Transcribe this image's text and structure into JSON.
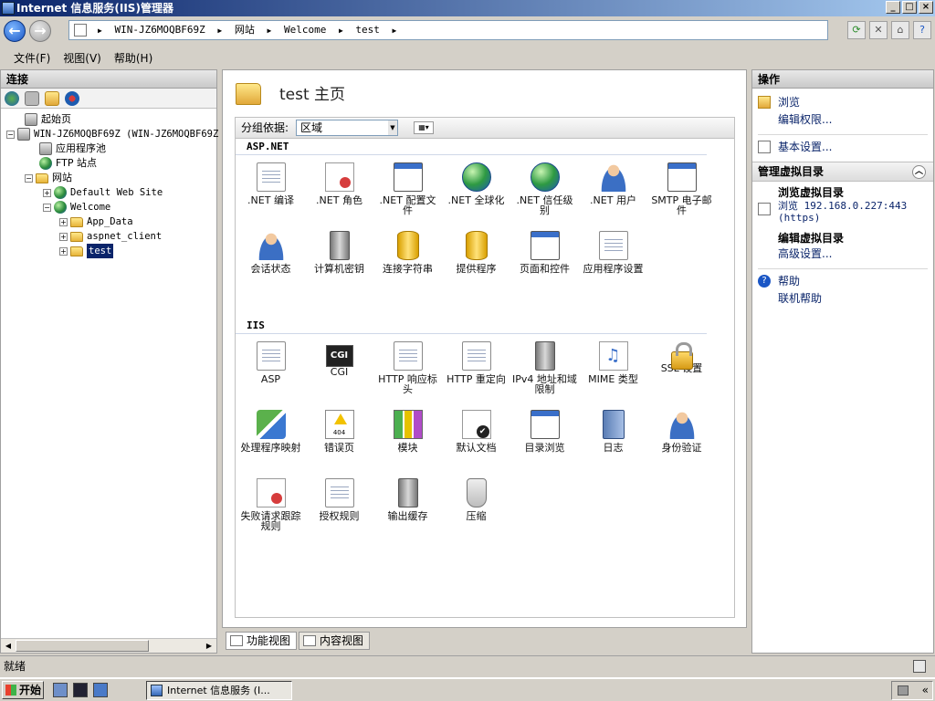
{
  "window": {
    "title": "Internet 信息服务(IIS)管理器"
  },
  "address": {
    "segments": [
      "WIN-JZ6MOQBF69Z",
      "网站",
      "Welcome",
      "test"
    ]
  },
  "menu": [
    "文件(F)",
    "视图(V)",
    "帮助(H)"
  ],
  "connections": {
    "title": "连接",
    "tree": {
      "start": "起始页",
      "server": "WIN-JZ6MOQBF69Z (WIN-JZ6MOQBF69Z",
      "apppools": "应用程序池",
      "ftp": "FTP 站点",
      "sites": "网站",
      "default_site": "Default Web Site",
      "welcome": "Welcome",
      "app_data": "App_Data",
      "aspnet_client": "aspnet_client",
      "test": "test"
    }
  },
  "main": {
    "title": "test 主页",
    "group_label": "分组依据:",
    "group_value": "区域",
    "sections": [
      {
        "name": "ASP.NET",
        "items": [
          {
            "label": ".NET 编译",
            "icon": "net-compile-icon"
          },
          {
            "label": ".NET 角色",
            "icon": "net-roles-icon"
          },
          {
            "label": ".NET 配置文件",
            "icon": "net-profile-icon"
          },
          {
            "label": ".NET 全球化",
            "icon": "net-globalization-icon"
          },
          {
            "label": ".NET 信任级别",
            "icon": "net-trust-icon"
          },
          {
            "label": ".NET 用户",
            "icon": "net-users-icon"
          },
          {
            "label": "SMTP 电子邮件",
            "icon": "smtp-icon"
          },
          {
            "label": "会话状态",
            "icon": "session-state-icon"
          },
          {
            "label": "计算机密钥",
            "icon": "machine-key-icon"
          },
          {
            "label": "连接字符串",
            "icon": "connection-strings-icon"
          },
          {
            "label": "提供程序",
            "icon": "providers-icon"
          },
          {
            "label": "页面和控件",
            "icon": "pages-controls-icon"
          },
          {
            "label": "应用程序设置",
            "icon": "app-settings-icon"
          }
        ]
      },
      {
        "name": "IIS",
        "items": [
          {
            "label": "ASP",
            "icon": "asp-icon"
          },
          {
            "label": "CGI",
            "icon": "cgi-icon"
          },
          {
            "label": "HTTP 响应标头",
            "icon": "http-headers-icon"
          },
          {
            "label": "HTTP 重定向",
            "icon": "http-redirect-icon"
          },
          {
            "label": "IPv4 地址和域限制",
            "icon": "ipv4-restrictions-icon"
          },
          {
            "label": "MIME 类型",
            "icon": "mime-icon"
          },
          {
            "label": "SSL 设置",
            "icon": "ssl-icon"
          },
          {
            "label": "处理程序映射",
            "icon": "handler-mappings-icon"
          },
          {
            "label": "错误页",
            "icon": "error-pages-icon"
          },
          {
            "label": "模块",
            "icon": "modules-icon"
          },
          {
            "label": "默认文档",
            "icon": "default-document-icon"
          },
          {
            "label": "目录浏览",
            "icon": "directory-browsing-icon"
          },
          {
            "label": "日志",
            "icon": "logging-icon"
          },
          {
            "label": "身份验证",
            "icon": "authentication-icon"
          },
          {
            "label": "失败请求跟踪规则",
            "icon": "failed-request-icon"
          },
          {
            "label": "授权规则",
            "icon": "authorization-icon"
          },
          {
            "label": "输出缓存",
            "icon": "output-cache-icon"
          },
          {
            "label": "压缩",
            "icon": "compression-icon"
          }
        ]
      }
    ],
    "tabs": [
      "功能视图",
      "内容视图"
    ]
  },
  "actions": {
    "title": "操作",
    "browse": "浏览",
    "edit_perms": "编辑权限...",
    "basic_settings": "基本设置...",
    "manage_vdir": "管理虚拟目录",
    "browse_vdir": "浏览虚拟目录",
    "browse_url": "浏览 192.168.0.227:443 (https)",
    "edit_vdir": "编辑虚拟目录",
    "advanced": "高级设置...",
    "help": "帮助",
    "online_help": "联机帮助"
  },
  "status": {
    "text": "就绪"
  },
  "taskbar": {
    "start": "开始",
    "item": "Internet 信息服务 (I..."
  }
}
